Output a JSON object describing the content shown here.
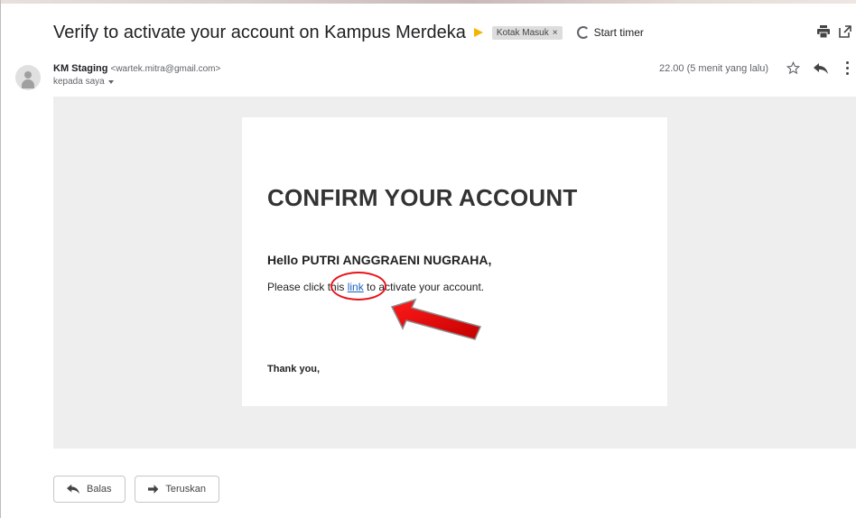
{
  "email": {
    "subject": "Verify to activate your account on Kampus Merdeka",
    "label": "Kotak Masuk",
    "label_close": "×",
    "timer": "Start timer",
    "sender_name": "KM Staging",
    "sender_email": "<wartek.mitra@gmail.com>",
    "recipient": "kepada saya",
    "timestamp": "22.00 (5 menit yang lalu)"
  },
  "content": {
    "title": "CONFIRM YOUR ACCOUNT",
    "greeting": "Hello PUTRI ANGGRAENI NUGRAHA,",
    "instruction_before": "Please click this ",
    "link_text": "link",
    "instruction_after": " to activate your account.",
    "closing": "Thank you,"
  },
  "actions": {
    "reply_label": "Balas",
    "forward_label": "Teruskan"
  },
  "colors": {
    "importance": "#f4b400",
    "link": "#1a5fc1",
    "annotation": "#e8141b"
  }
}
